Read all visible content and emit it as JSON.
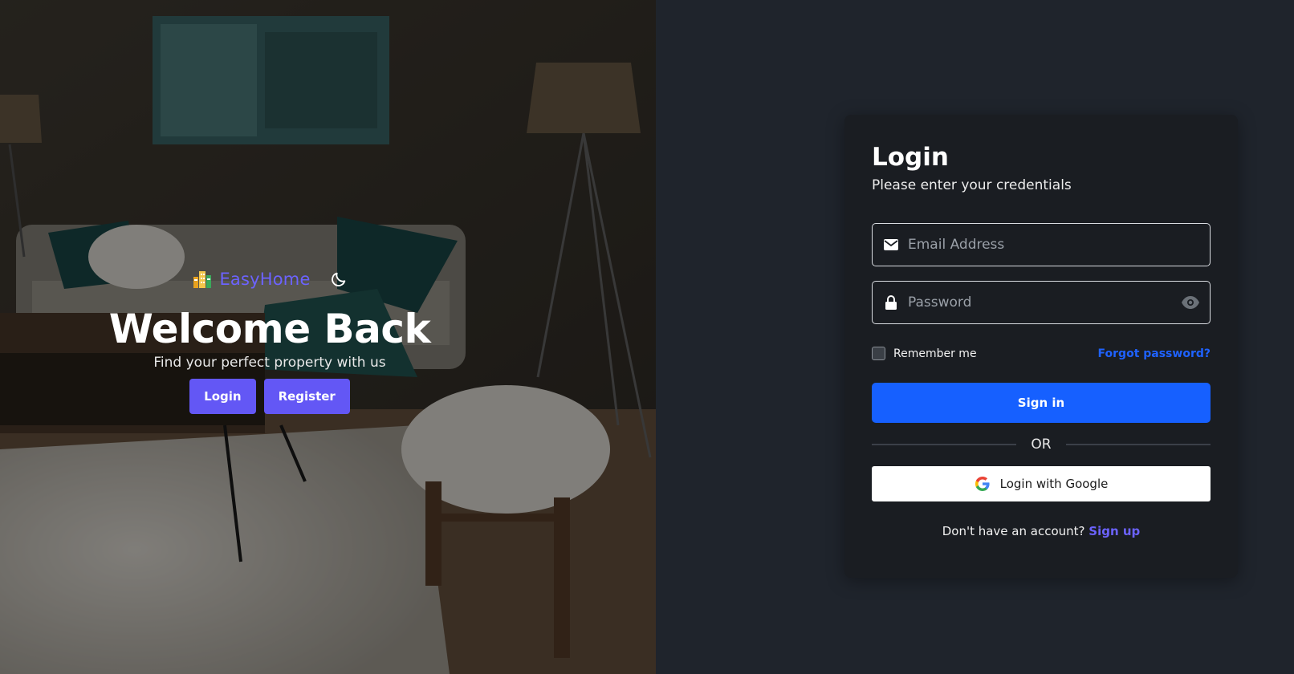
{
  "hero": {
    "brand_name": "EasyHome",
    "title": "Welcome Back",
    "subtitle": "Find your perfect property with us",
    "login_label": "Login",
    "register_label": "Register"
  },
  "login_card": {
    "title": "Login",
    "subtitle": "Please enter your credentials",
    "email_placeholder": "Email Address",
    "password_placeholder": "Password",
    "remember_label": "Remember me",
    "forgot_label": "Forgot password?",
    "signin_label": "Sign in",
    "or_label": "OR",
    "google_label": "Login with Google",
    "signup_prompt": "Don't have an account?",
    "signup_label": "Sign up"
  },
  "icons": {
    "brand": "building-logo-icon",
    "theme_toggle": "moon-icon",
    "email": "envelope-icon",
    "password": "lock-icon",
    "toggle_password": "eye-icon",
    "google": "google-icon"
  },
  "colors": {
    "brand_accent": "#6c63ff",
    "primary_button": "#1660ff",
    "hero_button": "#6357f5",
    "link_blue": "#1f62ff",
    "page_bg": "#1f242c",
    "card_bg": "#1a1d22"
  }
}
